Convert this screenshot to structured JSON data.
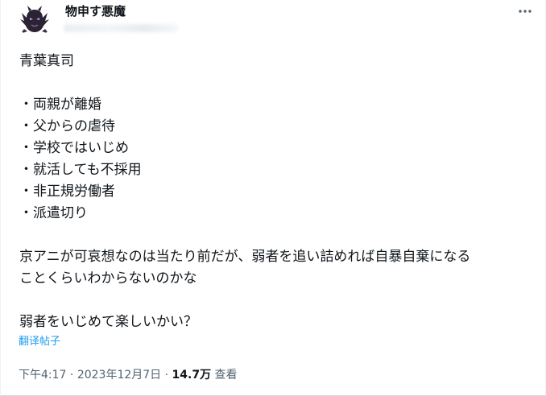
{
  "author": {
    "name": "物申す悪魔",
    "avatar_icon": "demon-avatar-icon"
  },
  "more_icon": "more-horizontal-icon",
  "tweet": {
    "lines": [
      "青葉真司",
      "",
      "・両親が離婚",
      "・父からの虐待",
      "・学校ではいじめ",
      "・就活しても不採用",
      "・非正規労働者",
      "・派遣切り",
      "",
      "京アニが可哀想なのは当たり前だが、弱者を追い詰めれば自暴自棄になる",
      "ことくらいわからないのかな",
      "",
      "弱者をいじめて楽しいかい？"
    ]
  },
  "translate_label": "翻译帖子",
  "meta": {
    "time": "下午4:17",
    "separator": "·",
    "date": "2023年12月7日",
    "views_count": "14.7万",
    "views_label": "查看"
  },
  "colors": {
    "text": "#0f1419",
    "secondary": "#536471",
    "link": "#1d9bf0"
  }
}
